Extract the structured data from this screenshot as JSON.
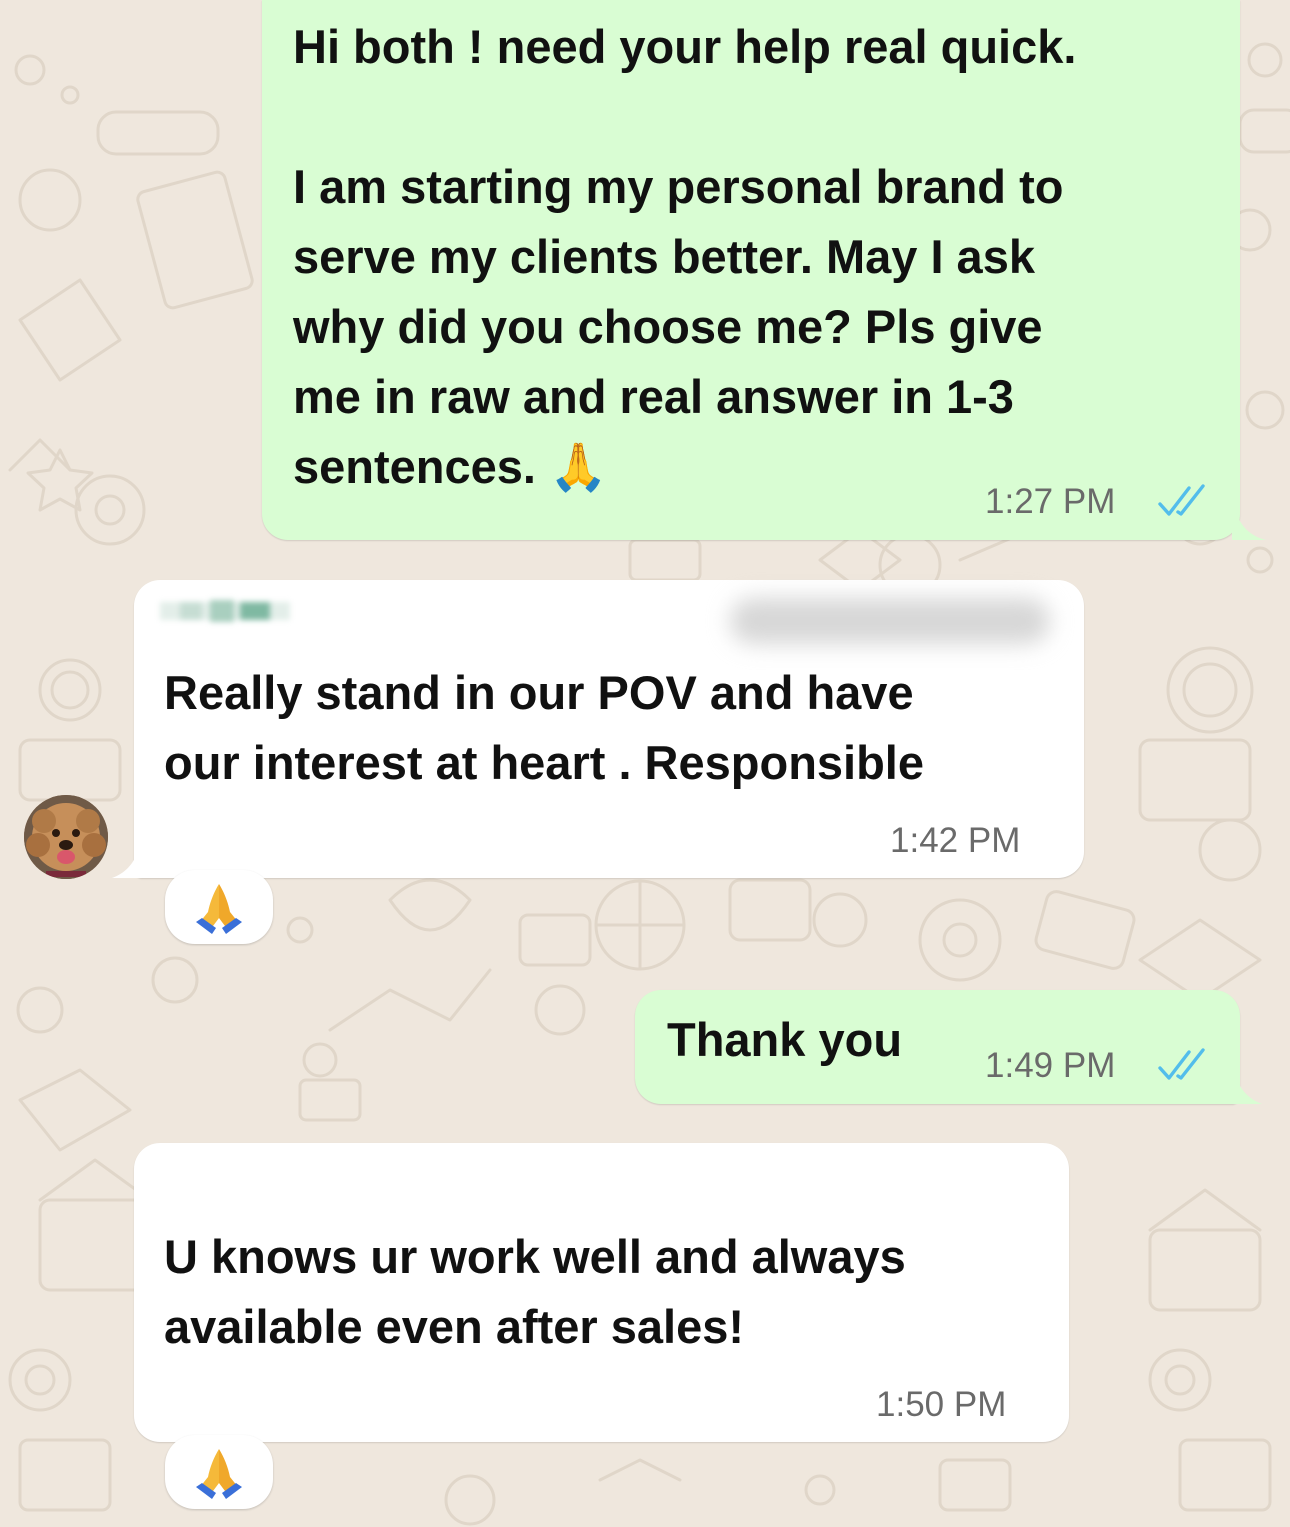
{
  "messages": [
    {
      "direction": "outgoing",
      "text": "Hi both ! need your help real quick.\n\nI am starting my personal brand to\nserve my clients better. May I ask\nwhy did you choose me? Pls give\nme in raw and real answer in 1-3\nsentences. 🙏",
      "time": "1:27 PM",
      "status": "read"
    },
    {
      "direction": "incoming",
      "text": "Really stand in our POV and have\nour interest at heart . Responsible",
      "time": "1:42 PM",
      "reaction": "🙏"
    },
    {
      "direction": "outgoing",
      "text": "Thank you",
      "time": "1:49 PM",
      "status": "read"
    },
    {
      "direction": "incoming",
      "text": "U knows ur work well and always\navailable even after sales!",
      "time": "1:50 PM",
      "reaction": "🙏"
    }
  ],
  "colors": {
    "chat_background": "#efe7dd",
    "outgoing_bubble": "#d9fdd3",
    "incoming_bubble": "#ffffff",
    "read_ticks": "#53bdeb"
  },
  "icons": {
    "read_receipt": "double-check-icon",
    "reaction": "folded-hands-emoji"
  }
}
